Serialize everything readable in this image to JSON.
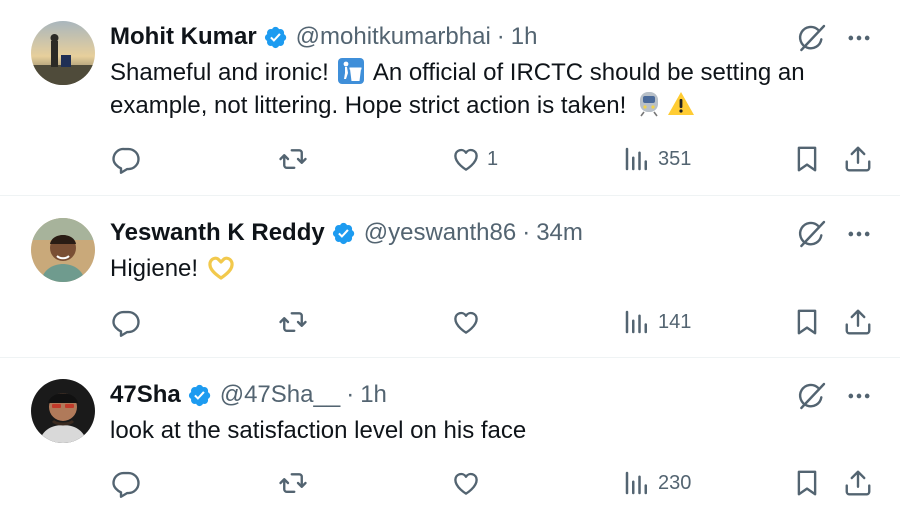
{
  "colors": {
    "text": "#0f1419",
    "secondary": "#536471",
    "verified": "#1d9bf0",
    "divider": "#eff3f4"
  },
  "tweets": [
    {
      "name": "Mohit Kumar",
      "handle": "@mohitkumarbhai",
      "separator": "·",
      "time": "1h",
      "text_line1": "Shameful and ironic! ",
      "text_line1b": " An official of IRCTC should be setting an",
      "text_line2": "example, not littering. Hope strict action is taken! ",
      "emojis": [
        "litter-bin-emoji",
        "train-emoji",
        "warning-emoji"
      ],
      "likes": "1",
      "views": "351"
    },
    {
      "name": "Yeswanth K Reddy",
      "handle": "@yeswanth86",
      "separator": "·",
      "time": "34m",
      "text": "Higiene! ",
      "emojis": [
        "heart-hands-emoji"
      ],
      "likes": "",
      "views": "141"
    },
    {
      "name": "47Sha",
      "handle": "@47Sha__",
      "separator": "·",
      "time": "1h",
      "text": "look at the satisfaction level on his face",
      "likes": "",
      "views": "230"
    }
  ],
  "icons": {
    "reply": "reply-icon",
    "retweet": "retweet-icon",
    "like": "heart-icon",
    "views": "views-icon",
    "bookmark": "bookmark-icon",
    "share": "share-icon",
    "grok": "grok-icon",
    "more": "more-icon",
    "verified": "verified-badge-icon"
  }
}
